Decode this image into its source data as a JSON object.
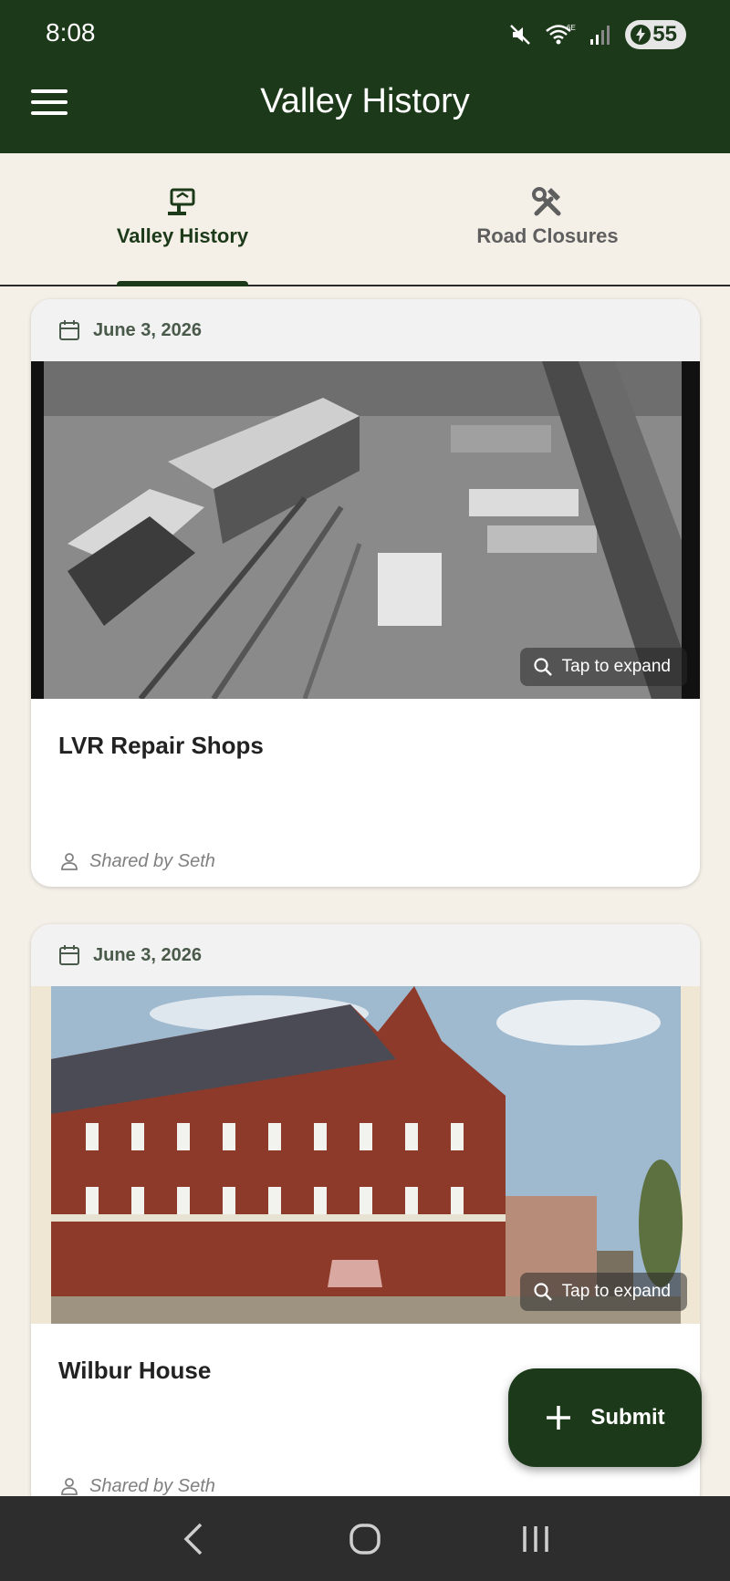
{
  "status_bar": {
    "time": "8:08",
    "battery": "55"
  },
  "app_bar": {
    "title": "Valley History"
  },
  "tabs": [
    {
      "label": "Valley History",
      "icon": "history-sign-icon",
      "active": true
    },
    {
      "label": "Road Closures",
      "icon": "tools-icon",
      "active": false
    }
  ],
  "posts": [
    {
      "date": "June 3, 2026",
      "title": "LVR Repair Shops",
      "author": "Shared by Seth",
      "expand_label": "Tap to expand"
    },
    {
      "date": "June 3, 2026",
      "title": "Wilbur House",
      "author": "Shared by Seth",
      "expand_label": "Tap to expand"
    }
  ],
  "fab": {
    "label": "Submit"
  },
  "colors": {
    "primary": "#1c3a1a",
    "background": "#f4f0e8",
    "card": "#ffffff",
    "date_bar": "#f2f2f2"
  }
}
